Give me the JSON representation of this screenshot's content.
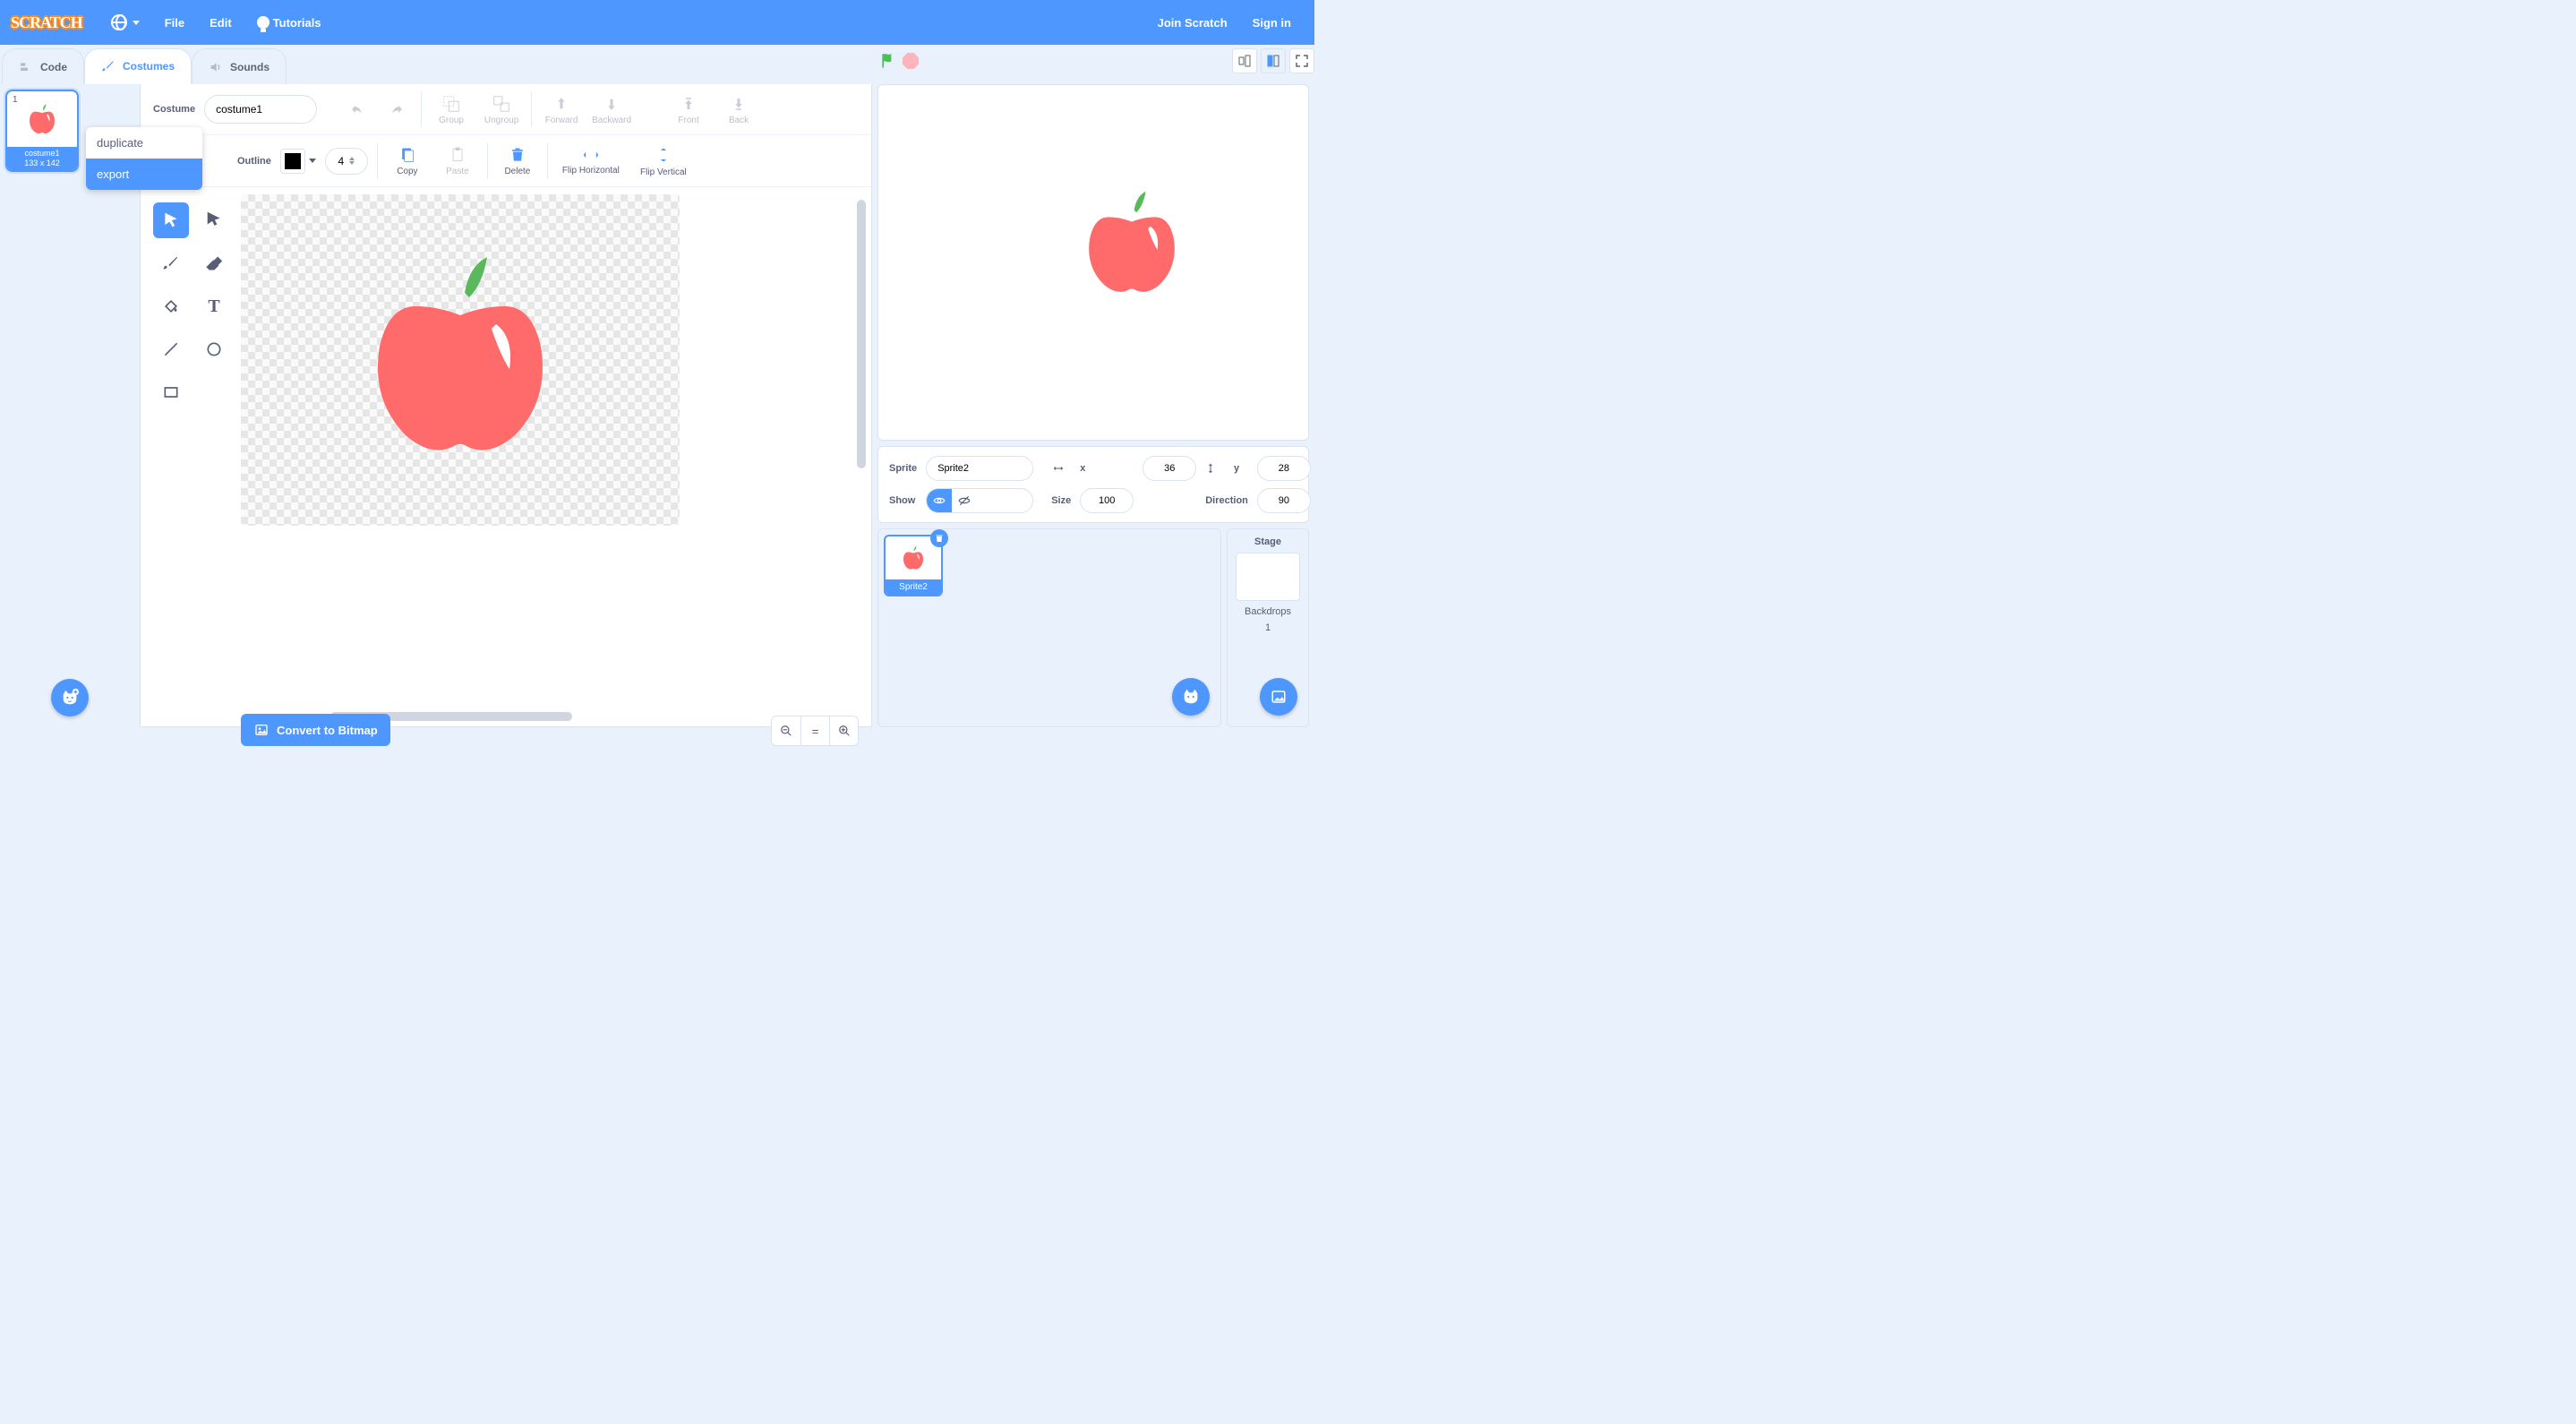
{
  "colors": {
    "accent": "#4d97ff",
    "apple_body": "#ff6b6b",
    "apple_stem": "#5cb85c",
    "highlight": "#ffffff"
  },
  "menubar": {
    "logo_text": "SCRATCH",
    "file": "File",
    "edit": "Edit",
    "tutorials": "Tutorials",
    "join": "Join Scratch",
    "signin": "Sign in"
  },
  "tabs": {
    "code": "Code",
    "costumes": "Costumes",
    "sounds": "Sounds",
    "active": "costumes"
  },
  "costume_list": {
    "items": [
      {
        "index": "1",
        "name": "costume1",
        "dims": "133 x 142"
      }
    ]
  },
  "context_menu": {
    "duplicate": "duplicate",
    "export": "export",
    "hovered": "export"
  },
  "paint": {
    "costume_label": "Costume",
    "costume_name": "costume1",
    "group": "Group",
    "ungroup": "Ungroup",
    "forward": "Forward",
    "backward": "Backward",
    "front": "Front",
    "back": "Back",
    "outline_label": "Outline",
    "outline_width": "4",
    "copy": "Copy",
    "paste": "Paste",
    "delete": "Delete",
    "flip_h": "Flip Horizontal",
    "flip_v": "Flip Vertical",
    "convert": "Convert to Bitmap"
  },
  "sprite_info": {
    "sprite_label": "Sprite",
    "sprite_name": "Sprite2",
    "x_label": "x",
    "x_val": "36",
    "y_label": "y",
    "y_val": "28",
    "show_label": "Show",
    "size_label": "Size",
    "size_val": "100",
    "direction_label": "Direction",
    "direction_val": "90"
  },
  "sprites": {
    "items": [
      {
        "name": "Sprite2"
      }
    ]
  },
  "stage": {
    "title": "Stage",
    "backdrops_label": "Backdrops",
    "backdrops_count": "1"
  }
}
